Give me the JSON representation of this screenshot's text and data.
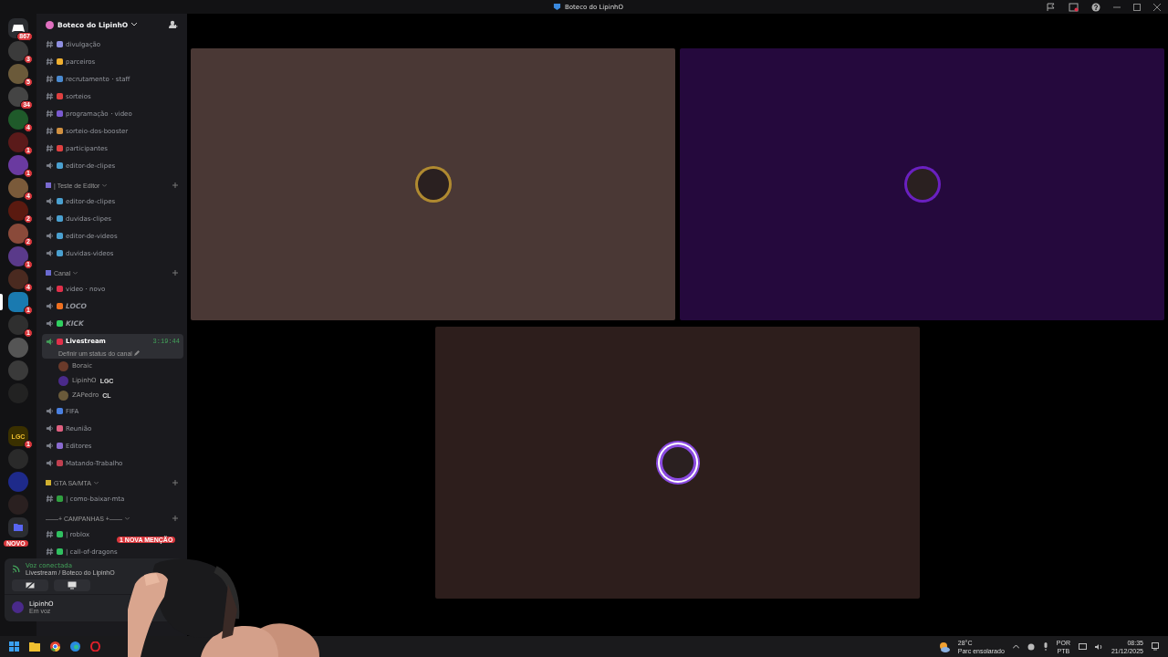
{
  "window": {
    "title": "Boteco do LipinhO"
  },
  "servers": [
    {
      "kind": "home",
      "badge": "867",
      "selected": false,
      "color": "#2b2d31"
    },
    {
      "kind": "avatar",
      "badge": "3",
      "selected": false,
      "color": "#3b3b3b"
    },
    {
      "kind": "avatar",
      "badge": "5",
      "selected": false,
      "color": "#6b5a3a"
    },
    {
      "kind": "avatar",
      "badge": "34",
      "selected": false,
      "color": "#444444"
    },
    {
      "kind": "avatar",
      "badge": "4",
      "selected": false,
      "color": "#1f5a2a"
    },
    {
      "kind": "avatar",
      "badge": "1",
      "selected": false,
      "color": "#5a1a1a"
    },
    {
      "kind": "avatar",
      "badge": "1",
      "selected": false,
      "color": "#6a3aa0"
    },
    {
      "kind": "avatar",
      "badge": "4",
      "selected": false,
      "color": "#7a5a3a"
    },
    {
      "kind": "avatar",
      "badge": "2",
      "selected": false,
      "color": "#5a1a10"
    },
    {
      "kind": "avatar",
      "badge": "2",
      "selected": false,
      "color": "#8a4a3a"
    },
    {
      "kind": "avatar",
      "badge": "1",
      "selected": false,
      "color": "#5a3a8a"
    },
    {
      "kind": "avatar",
      "badge": "4",
      "selected": false,
      "color": "#4a2a20"
    },
    {
      "kind": "avatar",
      "badge": "1",
      "selected": true,
      "color": "#1a7ab0"
    },
    {
      "kind": "avatar",
      "badge": "1",
      "selected": false,
      "color": "#2f2f2f"
    },
    {
      "kind": "avatar",
      "selected": false,
      "color": "#555555"
    },
    {
      "kind": "avatar",
      "selected": false,
      "color": "#3a3a3a"
    },
    {
      "kind": "avatar",
      "selected": false,
      "color": "#222222"
    },
    {
      "kind": "label",
      "label": "LGC",
      "badge": "1",
      "selected": false,
      "separated": true,
      "color": "#3a3000"
    },
    {
      "kind": "avatar",
      "selected": false,
      "color": "#2a2a2a"
    },
    {
      "kind": "avatar",
      "selected": false,
      "color": "#1e2a8a"
    },
    {
      "kind": "avatar",
      "selected": false,
      "color": "#2a2020"
    },
    {
      "kind": "folder",
      "selected": false,
      "color": "#2b2d31"
    }
  ],
  "novo_badge": "NOVO",
  "guild": {
    "name": "Boteco do LipinhO"
  },
  "channels": [
    {
      "kind": "text",
      "name": "divulgação",
      "color": "#8f8fe0",
      "selected": false
    },
    {
      "kind": "text",
      "name": "parceiros",
      "color": "#f0b030",
      "selected": false
    },
    {
      "kind": "text",
      "name": "recrutamento・staff",
      "color": "#4a8ad0",
      "selected": false
    },
    {
      "kind": "text",
      "name": "sorteios",
      "color": "#e04040",
      "selected": false
    },
    {
      "kind": "text",
      "name": "programação・video",
      "color": "#7a5ad0",
      "selected": false
    },
    {
      "kind": "text",
      "name": "sorteio-dos-booster",
      "color": "#d09040",
      "selected": false
    },
    {
      "kind": "text",
      "name": "participantes",
      "color": "#e04040",
      "selected": false
    },
    {
      "kind": "voice",
      "name": "editor-de-clipes",
      "color": "#4aa0d0",
      "selected": false
    },
    {
      "kind": "category",
      "name": "| Teste de Editor",
      "color": "#7a6ad0"
    },
    {
      "kind": "voice",
      "name": "editor-de-clipes",
      "color": "#4aa0d0",
      "selected": false
    },
    {
      "kind": "voice",
      "name": "duvidas-clipes",
      "color": "#4aa0d0",
      "selected": false
    },
    {
      "kind": "voice",
      "name": "editor-de-videos",
      "color": "#4aa0d0",
      "selected": false
    },
    {
      "kind": "voice",
      "name": "duvidas-videos",
      "color": "#4aa0d0",
      "selected": false
    },
    {
      "kind": "category",
      "name": "Canal",
      "color": "#6a6ad0"
    },
    {
      "kind": "voice",
      "name": "video・novo",
      "color": "#e0304a",
      "selected": false
    },
    {
      "kind": "voice",
      "name": "LOCO",
      "color": "#f07020",
      "selected": false,
      "italic": true
    },
    {
      "kind": "voice",
      "name": "KICK",
      "color": "#30d060",
      "selected": false,
      "italic": true
    },
    {
      "kind": "voice",
      "name": "Livestream",
      "color": "#e0304a",
      "selected": true,
      "timer": "3:19:44",
      "status": "Definir um status do canal",
      "members": [
        {
          "name": "Boraic",
          "color": "#6a3a2a"
        },
        {
          "name": "LipinhO",
          "tag": "LGC",
          "color": "#4a2a8a"
        },
        {
          "name": "ZAPedro",
          "tag": "CL",
          "color": "#6a5a3a"
        }
      ]
    },
    {
      "kind": "voice",
      "name": "FIFA",
      "color": "#4a80e0",
      "selected": false
    },
    {
      "kind": "voice",
      "name": "Reunião",
      "color": "#e06080",
      "selected": false
    },
    {
      "kind": "voice",
      "name": "Editores",
      "color": "#8a6ad0",
      "selected": false
    },
    {
      "kind": "voice",
      "name": "Matando-Trabalho",
      "color": "#c04050",
      "selected": false
    },
    {
      "kind": "category",
      "name": "GTA SA/MTA",
      "color": "#d0b030"
    },
    {
      "kind": "text",
      "name": "| como-baixar-mta",
      "color": "#30a040",
      "selected": false
    },
    {
      "kind": "category",
      "name": "——+ CAMPANHAS +——"
    },
    {
      "kind": "text",
      "name": "| roblox",
      "color": "#30c060",
      "selected": false
    },
    {
      "kind": "text",
      "name": "| call-of-dragons",
      "color": "#30c060",
      "selected": false
    }
  ],
  "mention_badge": "1 NOVA MENÇÃO",
  "voice_panel": {
    "title": "Voz conectada",
    "channel": "Livestream / Boteco do LipinhO"
  },
  "user": {
    "name": "LipinhO",
    "status": "Em voz"
  },
  "tiles": [
    {
      "color": "#4a3835",
      "avatar": {
        "color": "#b08a30"
      },
      "speaking": false
    },
    {
      "color": "#25093d",
      "avatar": {
        "color": "#6a20c0"
      },
      "speaking": false
    },
    {
      "color": "#2d1e1c",
      "avatar": {
        "color": "#8a4ae0"
      },
      "speaking": true
    }
  ],
  "taskbar": {
    "temp": "28°C",
    "weather": "Parc ensolarado",
    "lang": "POR",
    "layout": "PTB",
    "time": "08:35",
    "date": "21/12/2025"
  }
}
